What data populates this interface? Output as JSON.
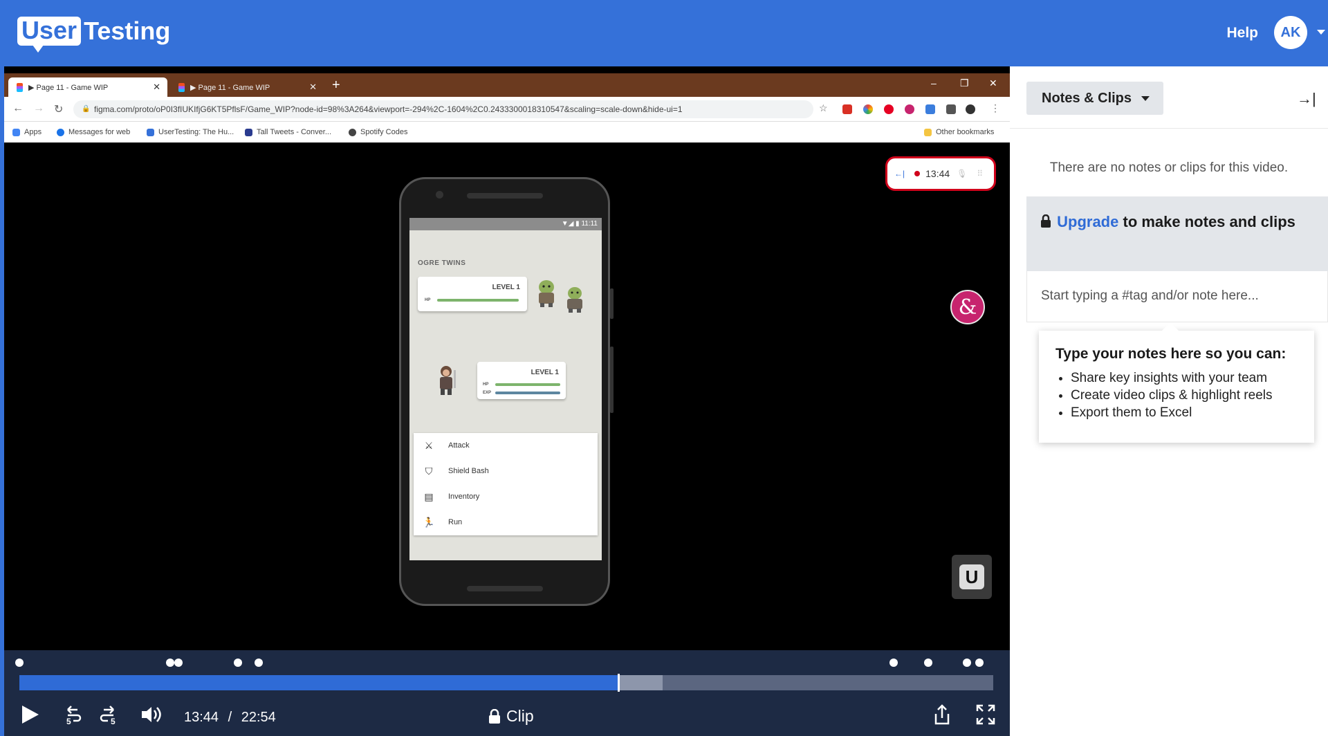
{
  "app": {
    "logo_boxed": "User",
    "logo_text": "Testing",
    "help_label": "Help",
    "avatar_initials": "AK",
    "brand_color": "#3571d9"
  },
  "browser": {
    "tabs": [
      {
        "label": "▶ Page 11 - Game WIP",
        "active": true
      },
      {
        "label": "▶ Page 11 - Game WIP",
        "active": false
      }
    ],
    "url": "figma.com/proto/oP0I3fIUKIfjG6KT5PflsF/Game_WIP?node-id=98%3A264&viewport=-294%2C-1604%2C0.2433300018310547&scaling=scale-down&hide-ui=1",
    "bookmarks": [
      "Apps",
      "Messages for web",
      "UserTesting: The Hu...",
      "Tall Tweets - Conver...",
      "Spotify Codes"
    ],
    "other_bookmarks": "Other bookmarks"
  },
  "phone": {
    "status_time": "11:11",
    "game_title": "OGRE TWINS",
    "enemy_level": "LEVEL 1",
    "player_level": "LEVEL 1",
    "hp_label": "HP",
    "exp_label": "EXP",
    "menu": [
      "Attack",
      "Shield Bash",
      "Inventory",
      "Run"
    ]
  },
  "recording": {
    "time": "13:44"
  },
  "player": {
    "current_time": "13:44",
    "separator": "/",
    "duration": "22:54",
    "clip_label": "Clip",
    "progress_played": 0.6145,
    "progress_buffered": 0.6605,
    "skip_back_seconds": "5",
    "skip_forward_seconds": "5"
  },
  "sidebar": {
    "dropdown_label": "Notes & Clips",
    "empty_message": "There are no notes or clips for this video.",
    "upgrade_link": "Upgrade",
    "upgrade_rest": " to make notes and clips",
    "note_placeholder": "Start typing a #tag and/or note here...",
    "tip_title": "Type your notes here so you can:",
    "tip_items": [
      "Share key insights with your team",
      "Create video clips & highlight reels",
      "Export them to Excel"
    ]
  }
}
